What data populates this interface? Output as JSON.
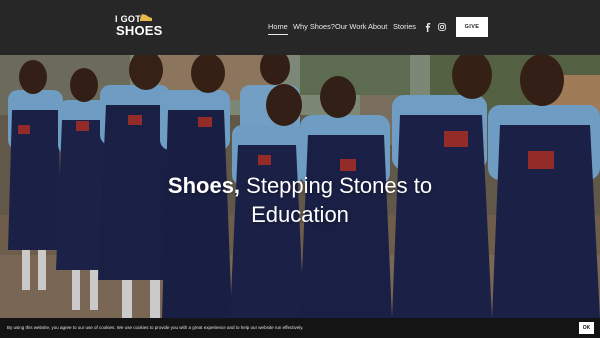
{
  "header": {
    "logo": {
      "line1": "I GOT",
      "line2": "SHOES"
    },
    "nav": [
      {
        "label": "Home",
        "active": true
      },
      {
        "label": "Why Shoes?",
        "active": false
      },
      {
        "label": "Our Work",
        "active": false
      },
      {
        "label": "About",
        "active": false
      },
      {
        "label": "Stories",
        "active": false
      }
    ],
    "social": [
      "facebook-icon",
      "instagram-icon"
    ],
    "give_label": "GIVE"
  },
  "hero": {
    "title_bold": "Shoes,",
    "title_rest_line1": " Stepping Stones to",
    "title_line2": "Education"
  },
  "cookie_bar": {
    "text": "By using this website, you agree to our use of cookies. We use cookies to provide you with a great experience and to help our website run effectively.",
    "ok_label": "OK"
  },
  "colors": {
    "header_bg": "#272727",
    "cookie_bg": "#141414",
    "uniform_navy": "#1f2650",
    "shirt_blue": "#7fb2dd"
  }
}
